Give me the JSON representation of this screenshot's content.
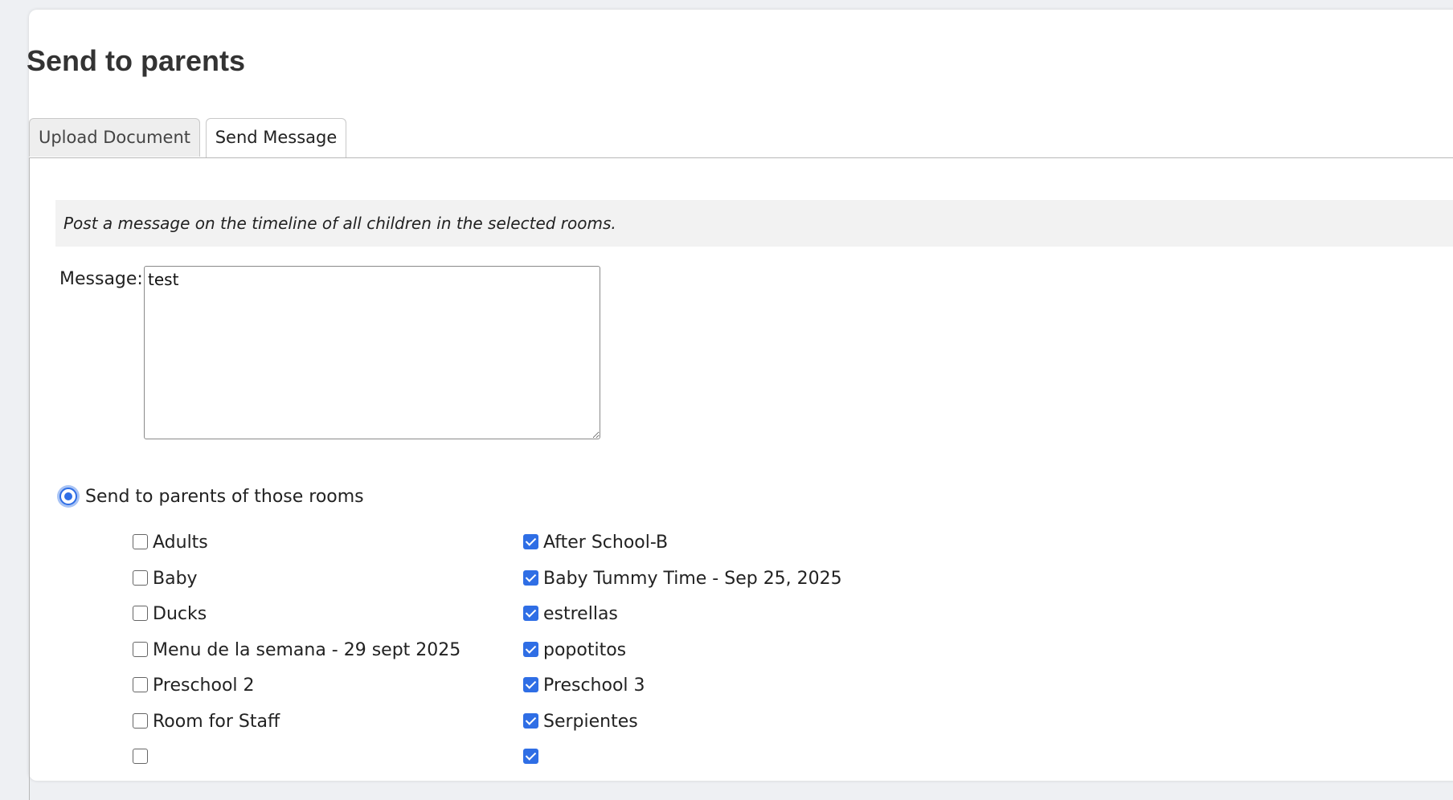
{
  "page": {
    "title": "Send to parents"
  },
  "tabs": [
    {
      "label": "Upload Document",
      "active": false
    },
    {
      "label": "Send Message",
      "active": true
    }
  ],
  "panel": {
    "info_text": "Post a message on the timeline of all children in the selected rooms.",
    "message_label": "Message:",
    "message_value": "test",
    "radio_label": "Send to parents of those rooms",
    "radio_selected": true
  },
  "rooms_left": [
    {
      "label": "Adults",
      "checked": false
    },
    {
      "label": "Baby",
      "checked": false
    },
    {
      "label": "Ducks",
      "checked": false
    },
    {
      "label": "Menu de la semana - 29 sept 2025",
      "checked": false
    },
    {
      "label": "Preschool 2",
      "checked": false
    },
    {
      "label": "Room for Staff",
      "checked": false
    },
    {
      "label": "",
      "checked": false
    }
  ],
  "rooms_right": [
    {
      "label": "After School-B",
      "checked": true
    },
    {
      "label": "Baby Tummy Time - Sep 25, 2025",
      "checked": true
    },
    {
      "label": "estrellas",
      "checked": true
    },
    {
      "label": "popotitos",
      "checked": true
    },
    {
      "label": "Preschool 3",
      "checked": true
    },
    {
      "label": "Serpientes",
      "checked": true
    },
    {
      "label": "",
      "checked": true
    }
  ],
  "colors": {
    "accent": "#2f6ee5",
    "info_bg": "#f2f2f2"
  }
}
